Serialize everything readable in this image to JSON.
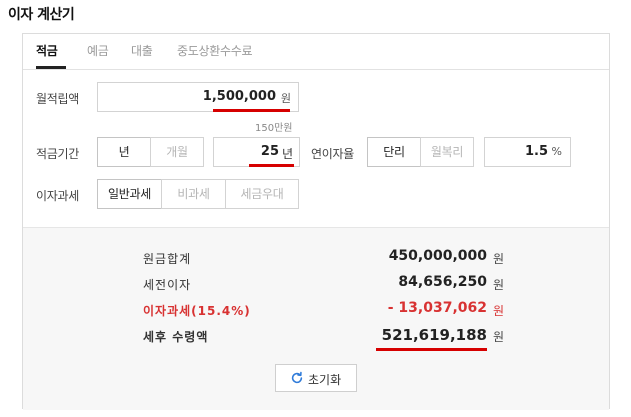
{
  "page_title": "이자 계산기",
  "tabs": [
    {
      "label": "적금"
    },
    {
      "label": "예금"
    },
    {
      "label": "대출"
    },
    {
      "label": "중도상환수수료"
    }
  ],
  "monthly_deposit": {
    "label": "월적립액",
    "value": "1,500,000",
    "unit": "원",
    "hint": "150만원"
  },
  "period": {
    "label": "적금기간",
    "options": [
      "년",
      "개월"
    ],
    "selected": "년",
    "value": "25",
    "unit": "년"
  },
  "rate": {
    "label": "연이자율",
    "options": [
      "단리",
      "월복리"
    ],
    "selected": "단리",
    "value": "1.5",
    "unit": "%"
  },
  "tax": {
    "label": "이자과세",
    "options": [
      "일반과세",
      "비과세",
      "세금우대"
    ],
    "selected": "일반과세"
  },
  "summary": {
    "principal_label": "원금합계",
    "principal_value": "450,000,000",
    "pretax_label": "세전이자",
    "pretax_value": "84,656,250",
    "tax_label": "이자과세(15.4%)",
    "tax_value": "- 13,037,062",
    "net_label": "세후 수령액",
    "net_value": "521,619,188",
    "unit": "원"
  },
  "reset_label": "초기화",
  "colors": {
    "accent_red": "#d60000",
    "tax_red": "#d83232"
  }
}
